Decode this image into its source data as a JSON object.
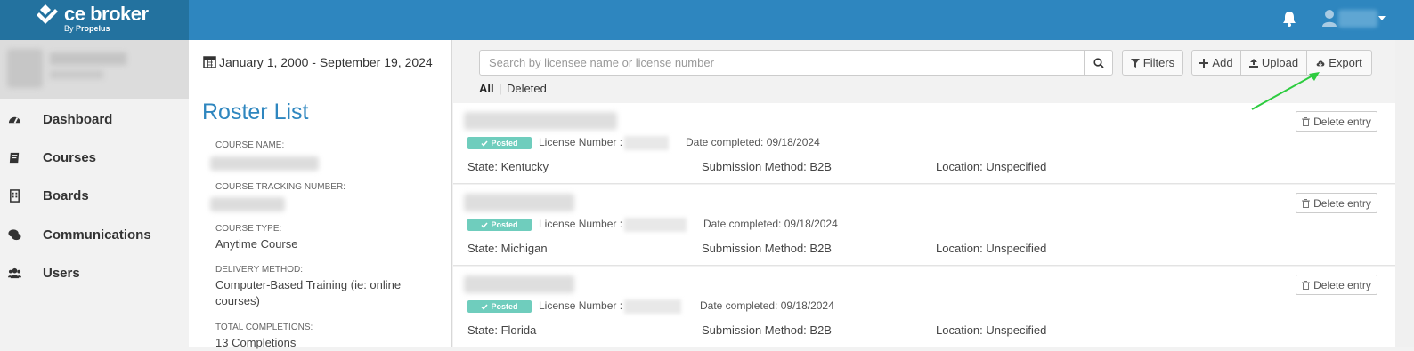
{
  "app": {
    "logo_text": "ce broker",
    "logo_sub_prefix": "By ",
    "logo_sub_brand": "Propelus",
    "icons": [
      "bell-icon",
      "user-icon"
    ]
  },
  "sidebar": {
    "items": [
      {
        "label": "Dashboard",
        "icon": "dashboard-icon"
      },
      {
        "label": "Courses",
        "icon": "book-icon"
      },
      {
        "label": "Boards",
        "icon": "building-icon"
      },
      {
        "label": "Communications",
        "icon": "comments-icon"
      },
      {
        "label": "Users",
        "icon": "users-icon"
      }
    ]
  },
  "details": {
    "date_range": "January 1, 2000 - September 19, 2024",
    "title": "Roster List",
    "course_name_label": "COURSE NAME:",
    "tracking_label": "COURSE TRACKING NUMBER:",
    "course_type_label": "COURSE TYPE:",
    "course_type_value": "Anytime Course",
    "delivery_label": "DELIVERY METHOD:",
    "delivery_value": "Computer-Based Training (ie: online courses)",
    "total_label": "TOTAL COMPLETIONS:",
    "total_value": "13 Completions"
  },
  "toolbar": {
    "search_placeholder": "Search by licensee name or license number",
    "filters_label": "Filters",
    "add_label": "Add",
    "upload_label": "Upload",
    "export_label": "Export"
  },
  "tabs": {
    "all": "All",
    "separator": "|",
    "deleted": "Deleted"
  },
  "entries": [
    {
      "status": "Posted",
      "license_label": "License Number :",
      "date_completed": "Date completed:   09/18/2024",
      "state": "State: Kentucky",
      "submission": "Submission Method:   B2B",
      "location": "Location:   Unspecified",
      "delete_label": "Delete entry"
    },
    {
      "status": "Posted",
      "license_label": "License Number :",
      "date_completed": "Date completed:   09/18/2024",
      "state": "State: Michigan",
      "submission": "Submission Method:   B2B",
      "location": "Location:   Unspecified",
      "delete_label": "Delete entry"
    },
    {
      "status": "Posted",
      "license_label": "License Number :",
      "date_completed": "Date completed:   09/18/2024",
      "state": "State: Florida",
      "submission": "Submission Method:   B2B",
      "location": "Location:   Unspecified",
      "delete_label": "Delete entry"
    }
  ],
  "colors": {
    "topbar": "#2e86bf",
    "logo_bg": "#23729f",
    "accent": "#2e86bf",
    "posted_badge": "#6fcdbd",
    "arrow": "#2ecc40"
  }
}
